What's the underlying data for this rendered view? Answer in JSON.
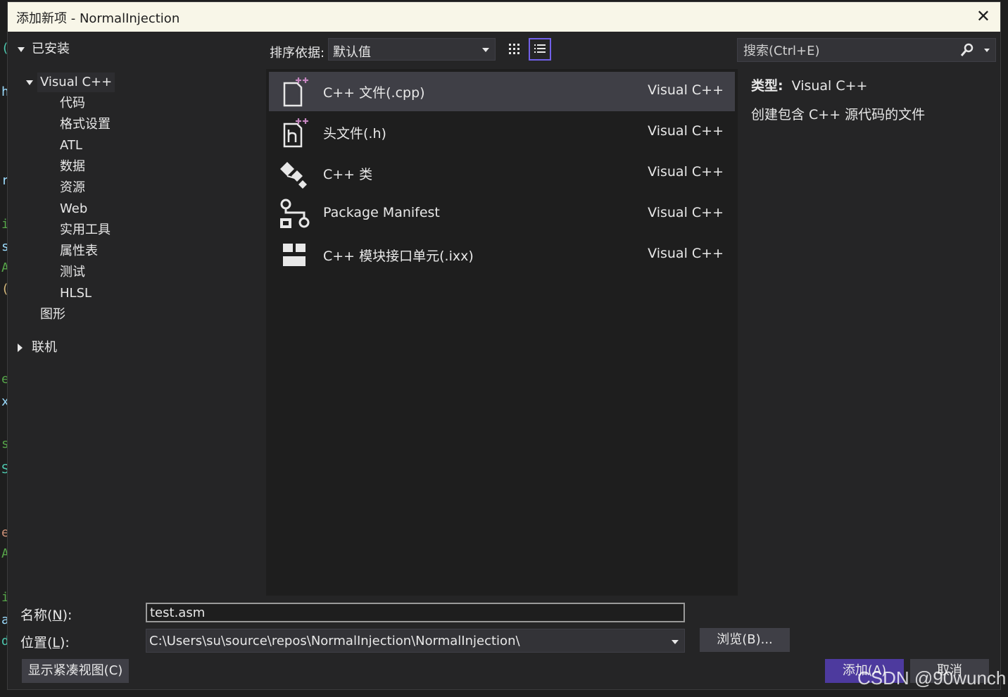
{
  "dialog": {
    "title": "添加新项 - NormalInjection"
  },
  "tree": {
    "installed": "已安装",
    "visual_cpp": "Visual C++",
    "children": [
      "代码",
      "格式设置",
      "ATL",
      "数据",
      "资源",
      "Web",
      "实用工具",
      "属性表",
      "测试",
      "HLSL"
    ],
    "graphics": "图形",
    "online": "联机"
  },
  "toolbar": {
    "sort_label": "排序依据:",
    "sort_value": "默认值"
  },
  "search": {
    "placeholder": "搜索(Ctrl+E)"
  },
  "templates": [
    {
      "name": "C++ 文件(.cpp)",
      "lang": "Visual C++",
      "icon": "cpp-file-icon"
    },
    {
      "name": "头文件(.h)",
      "lang": "Visual C++",
      "icon": "header-file-icon"
    },
    {
      "name": "C++ 类",
      "lang": "Visual C++",
      "icon": "cpp-class-icon"
    },
    {
      "name": "Package Manifest",
      "lang": "Visual C++",
      "icon": "package-manifest-icon"
    },
    {
      "name": "C++ 模块接口单元(.ixx)",
      "lang": "Visual C++",
      "icon": "module-interface-icon"
    }
  ],
  "details": {
    "type_label": "类型:",
    "type_value": "Visual C++",
    "description": "创建包含 C++ 源代码的文件"
  },
  "form": {
    "name_label_pre": "名称(",
    "name_label_key": "N",
    "name_label_post": "):",
    "name_value": "test.asm",
    "location_label_pre": "位置(",
    "location_label_key": "L",
    "location_label_post": "):",
    "location_value": "C:\\Users\\su\\source\\repos\\NormalInjection\\NormalInjection\\",
    "browse_label": "浏览(B)...",
    "compact_label": "显示紧凑视图(C)",
    "add_label": "添加(A)",
    "cancel_label": "取消"
  },
  "watermark": "CSDN @90wunch",
  "colors": {
    "accent": "#7160e8",
    "add_button": "#4d3a9e",
    "title_bar": "#f8f6e8"
  }
}
